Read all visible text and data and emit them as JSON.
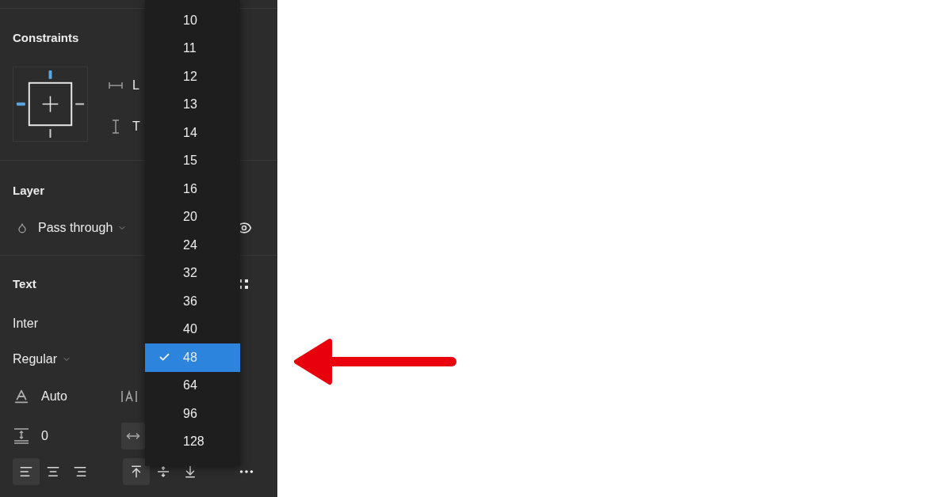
{
  "constraints": {
    "title": "Constraints",
    "horizontal_label": "L",
    "vertical_label": "T",
    "pins": {
      "top": true,
      "left": true,
      "right": false,
      "bottom": false
    }
  },
  "layer": {
    "title": "Layer",
    "blend_mode": "Pass through"
  },
  "text": {
    "title": "Text",
    "font_family": "Inter",
    "font_weight": "Regular",
    "line_height": "Auto",
    "paragraph_spacing": "0",
    "horizontal_align": [
      {
        "kind": "left",
        "selected": true
      },
      {
        "kind": "center",
        "selected": false
      },
      {
        "kind": "right",
        "selected": false
      }
    ],
    "vertical_align": [
      {
        "kind": "top",
        "selected": true
      },
      {
        "kind": "middle",
        "selected": false
      },
      {
        "kind": "bottom",
        "selected": false
      }
    ]
  },
  "font_size_menu": {
    "items": [
      {
        "label": "10",
        "selected": false
      },
      {
        "label": "11",
        "selected": false
      },
      {
        "label": "12",
        "selected": false
      },
      {
        "label": "13",
        "selected": false
      },
      {
        "label": "14",
        "selected": false
      },
      {
        "label": "15",
        "selected": false
      },
      {
        "label": "16",
        "selected": false
      },
      {
        "label": "20",
        "selected": false
      },
      {
        "label": "24",
        "selected": false
      },
      {
        "label": "32",
        "selected": false
      },
      {
        "label": "36",
        "selected": false
      },
      {
        "label": "40",
        "selected": false
      },
      {
        "label": "48",
        "selected": true
      },
      {
        "label": "64",
        "selected": false
      },
      {
        "label": "96",
        "selected": false
      },
      {
        "label": "128",
        "selected": false
      }
    ]
  }
}
